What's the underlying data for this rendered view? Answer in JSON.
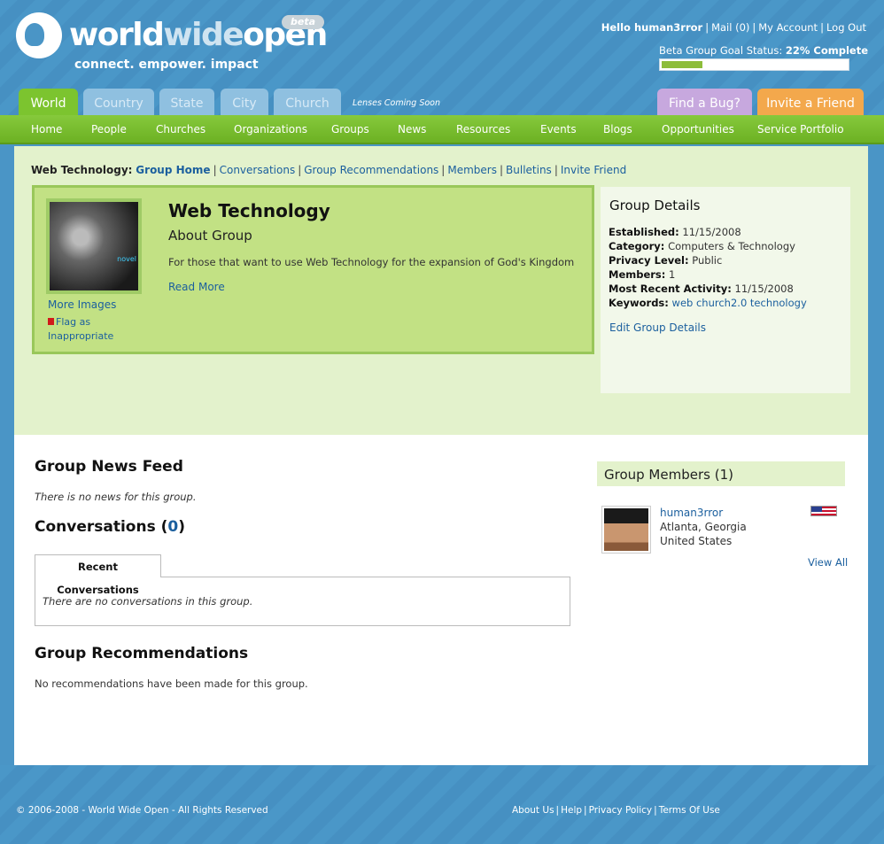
{
  "logo": {
    "text_left": "world",
    "text_mid": "wide",
    "text_right": "open",
    "beta": "beta",
    "tagline": "connect. empower. impact"
  },
  "user": {
    "hello": "Hello human3rror",
    "mail": "Mail (0)",
    "account": "My Account",
    "logout": "Log Out"
  },
  "goal": {
    "label": "Beta Group Goal Status:",
    "percent_text": "22% Complete",
    "percent": 22
  },
  "lens_tabs": [
    "World",
    "Country",
    "State",
    "City",
    "Church"
  ],
  "lens_note": "Lenses Coming Soon",
  "right_tabs": {
    "bug": "Find a Bug?",
    "invite": "Invite a Friend"
  },
  "nav": [
    "Home",
    "People",
    "Churches",
    "Organizations",
    "Groups",
    "News",
    "Resources",
    "Events",
    "Blogs",
    "Opportunities",
    "Service Portfolio"
  ],
  "breadcrumb": {
    "prefix": "Web Technology:",
    "items": [
      "Group Home",
      "Conversations",
      "Group Recommendations",
      "Members",
      "Bulletins",
      "Invite Friend"
    ]
  },
  "group": {
    "name": "Web Technology",
    "about_title": "About Group",
    "description": "For those that want to use Web Technology for the expansion of God's Kingdom",
    "read_more": "Read More",
    "more_images": "More Images",
    "flag": "Flag as Inappropriate"
  },
  "details": {
    "title": "Group Details",
    "rows": [
      {
        "label": "Established:",
        "value": "11/15/2008"
      },
      {
        "label": "Category:",
        "value": "Computers & Technology"
      },
      {
        "label": "Privacy Level:",
        "value": "Public"
      },
      {
        "label": "Members:",
        "value": "1"
      },
      {
        "label": "Most Recent Activity:",
        "value": "11/15/2008"
      }
    ],
    "keywords_label": "Keywords:",
    "keywords": "web church2.0 technology",
    "edit": "Edit Group Details"
  },
  "news": {
    "title": "Group News Feed",
    "empty": "There is no news for this group."
  },
  "conversations": {
    "title": "Conversations",
    "count": "0",
    "tab": "Recent Conversations",
    "empty": "There are no conversations in this group."
  },
  "recommendations": {
    "title": "Group Recommendations",
    "empty": "No recommendations have been made for this group."
  },
  "members": {
    "title": "Group Members (1)",
    "name": "human3rror",
    "city": "Atlanta, Georgia",
    "country": "United States",
    "view_all": "View All"
  },
  "footer": {
    "copyright": "© 2006-2008 - World Wide Open - All Rights Reserved",
    "links": [
      "About Us",
      "Help",
      "Privacy Policy",
      "Terms Of Use"
    ]
  }
}
